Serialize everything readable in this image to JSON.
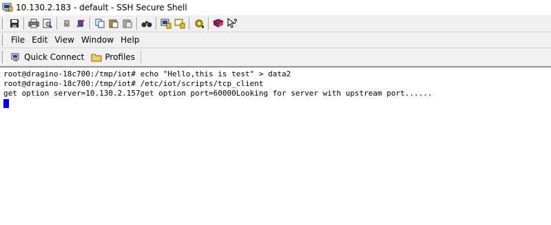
{
  "window": {
    "title": "10.130.2.183 - default - SSH Secure Shell"
  },
  "toolbar": {
    "buttons": [
      {
        "name": "save-icon"
      },
      {
        "name": "print-icon"
      },
      {
        "name": "print-preview-icon"
      },
      {
        "name": "disconnect-icon"
      },
      {
        "name": "connect-icon"
      },
      {
        "name": "copy-icon"
      },
      {
        "name": "paste-icon"
      },
      {
        "name": "paste-special-icon"
      },
      {
        "name": "find-icon"
      },
      {
        "name": "new-terminal-icon"
      },
      {
        "name": "new-file-transfer-icon"
      },
      {
        "name": "settings-icon"
      },
      {
        "name": "help-book-icon"
      },
      {
        "name": "context-help-icon"
      }
    ]
  },
  "menu": {
    "file": "File",
    "edit": "Edit",
    "view": "View",
    "window": "Window",
    "help": "Help"
  },
  "profilebar": {
    "quick_connect": "Quick Connect",
    "profiles": "Profiles"
  },
  "terminal": {
    "lines": [
      "root@dragino-18c700:/tmp/iot# echo \"Hello,this is test\" > data2",
      "root@dragino-18c700:/tmp/iot# /etc/iot/scripts/tcp_client",
      "get option server=10.130.2.157get option port=60000Looking for server with upstream port......"
    ],
    "cursor_color": "#0000ff"
  }
}
